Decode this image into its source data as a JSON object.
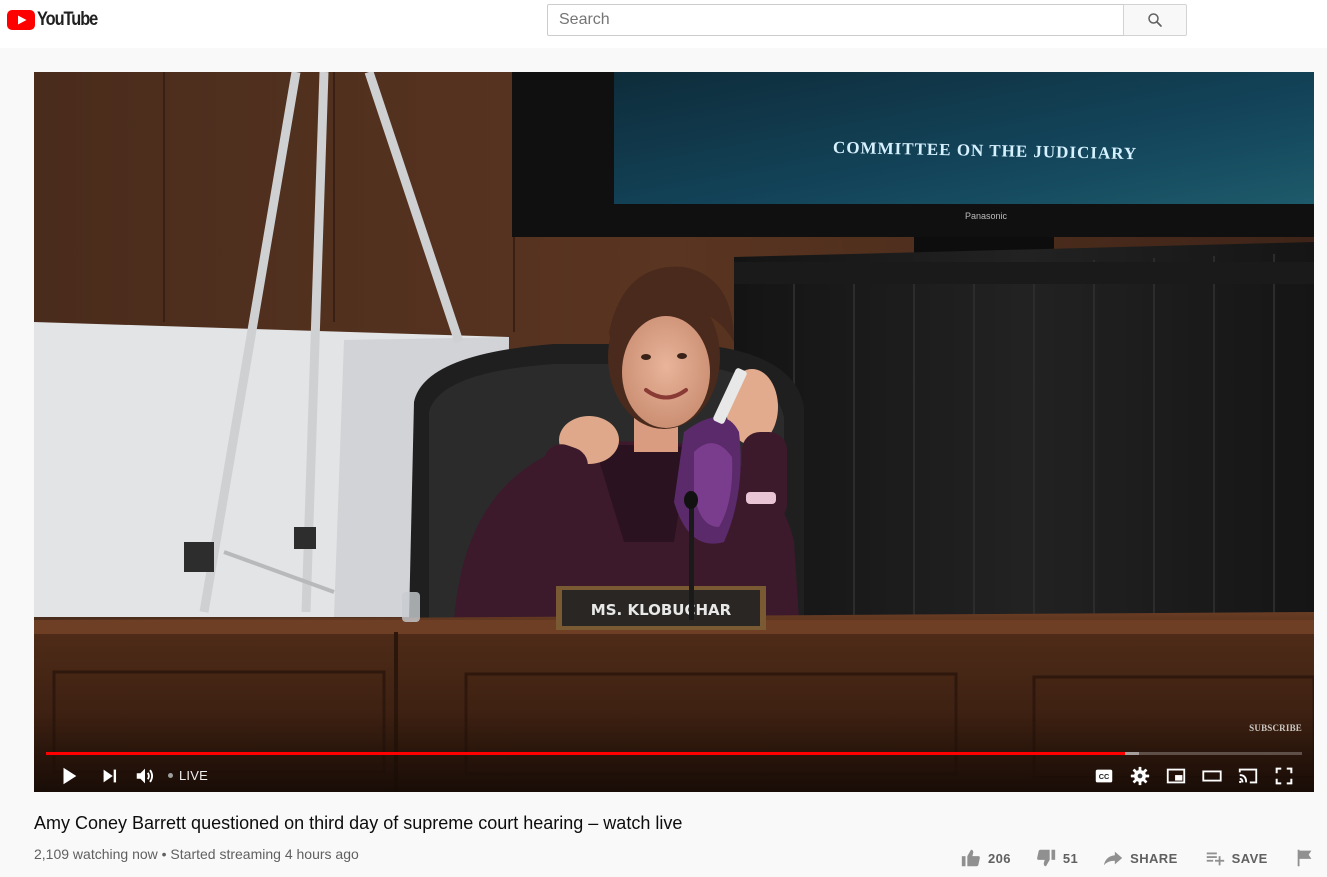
{
  "masthead": {
    "logo_text": "YouTube",
    "logo_icon": "youtube-play-logo-icon",
    "brand_color": "#ff0000",
    "search_placeholder": "Search",
    "search_icon": "search-icon"
  },
  "player": {
    "scene": {
      "tv_text": "COMMITTEE ON THE JUDICIARY",
      "tv_brand": "Panasonic",
      "nameplate": "MS. KLOBUCHAR"
    },
    "watermark": "SUBSCRIBE",
    "progress": {
      "played_fraction": 0.859,
      "buffered_fraction": 0.87,
      "played_color": "#ff0000"
    },
    "controls": {
      "left": [
        "play-icon",
        "next-icon",
        "volume-icon"
      ],
      "live_label": "LIVE",
      "right": [
        "captions-icon",
        "settings-icon",
        "miniplayer-icon",
        "theater-mode-icon",
        "cast-icon",
        "fullscreen-icon"
      ]
    }
  },
  "video": {
    "title": "Amy Coney Barrett questioned on third day of supreme court hearing – watch live",
    "meta": "2,109 watching now • Started streaming 4 hours ago",
    "actions": {
      "like_count": "206",
      "dislike_count": "51",
      "share_label": "SHARE",
      "save_label": "SAVE"
    }
  }
}
